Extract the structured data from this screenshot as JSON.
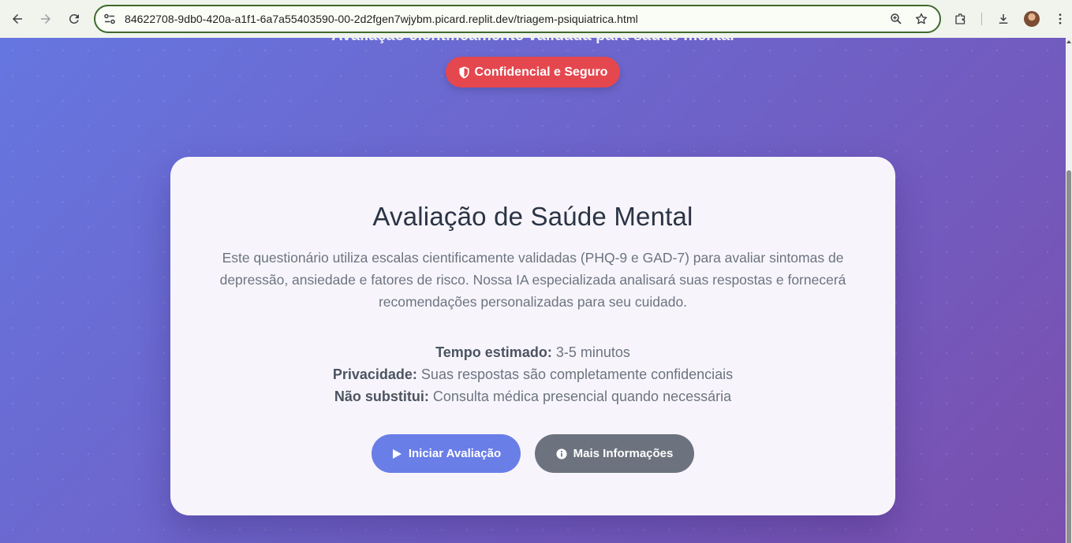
{
  "browser": {
    "url": "84622708-9db0-420a-a1f1-6a7a55403590-00-2d2fgen7wjybm.picard.replit.dev/triagem-psiquiatrica.html",
    "icons": [
      "back-icon",
      "forward-icon",
      "reload-icon",
      "site-settings-icon",
      "zoom-icon",
      "bookmark-star-icon",
      "extensions-icon",
      "download-icon",
      "profile-avatar",
      "more-menu-icon"
    ]
  },
  "hero": {
    "subtitle": "Avaliação cientificamente validada para saúde mental",
    "badge_label": "Confidencial e Seguro"
  },
  "card": {
    "title": "Avaliação de Saúde Mental",
    "description": "Este questionário utiliza escalas cientificamente validadas (PHQ-9 e GAD-7) para avaliar sintomas de depressão, ansiedade e fatores de risco. Nossa IA especializada analisará suas respostas e fornecerá recomendações personalizadas para seu cuidado.",
    "info": [
      {
        "label": "Tempo estimado:",
        "value": "3-5 minutos"
      },
      {
        "label": "Privacidade:",
        "value": "Suas respostas são completamente confidenciais"
      },
      {
        "label": "Não substitui:",
        "value": "Consulta médica presencial quando necessária"
      }
    ],
    "primary_button": "Iniciar Avaliação",
    "secondary_button": "Mais Informações"
  },
  "colors": {
    "badge": "#e5474f",
    "primary_button": "#6a7ee8",
    "secondary_button": "#6c737e",
    "background_start": "#6676e0",
    "background_end": "#7a4fae"
  }
}
